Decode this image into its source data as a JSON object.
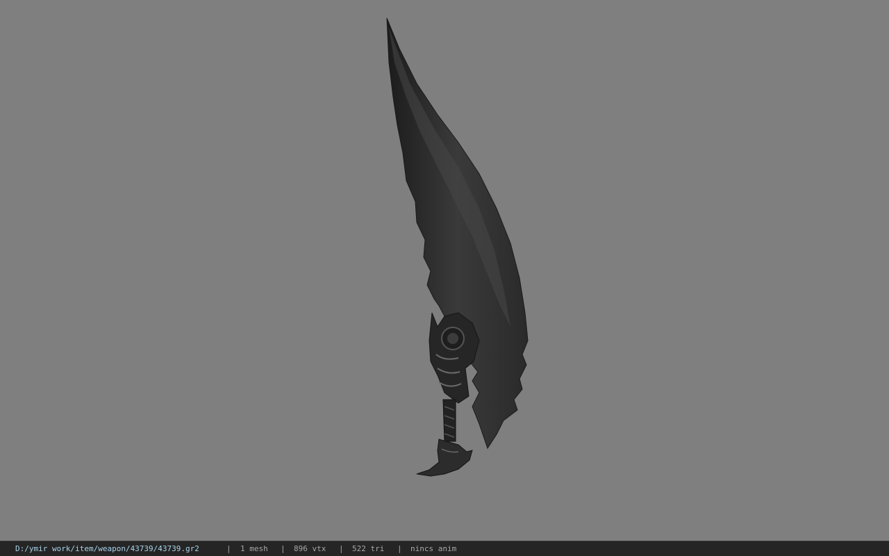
{
  "viewer": {
    "background_color": "#7f7f7f",
    "model_icon": "weapon-mesh-icon"
  },
  "status_bar": {
    "file_path": "D:/ymir work/item/weapon/43739/43739.gr2",
    "separator": "|",
    "mesh_count": "1 mesh",
    "vertex_count": "896 vtx",
    "triangle_count": "522 tri",
    "animation": "nincs anim",
    "path_color": "#a9d3ea",
    "text_color": "#a8a8a8"
  }
}
